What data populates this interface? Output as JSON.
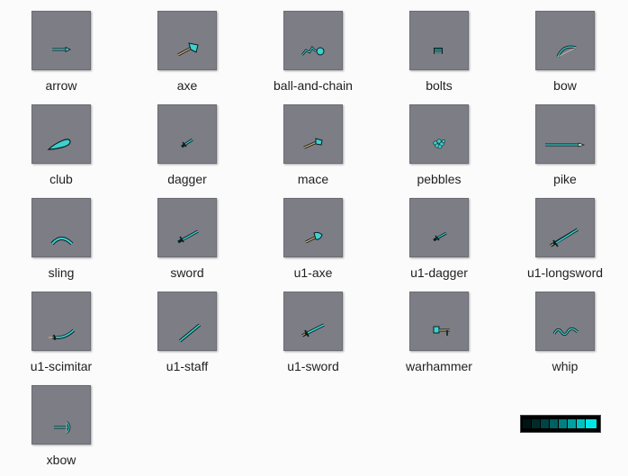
{
  "items": [
    {
      "label": "arrow",
      "icon": "arrow-icon"
    },
    {
      "label": "axe",
      "icon": "axe-icon"
    },
    {
      "label": "ball-and-chain",
      "icon": "ball-and-chain-icon"
    },
    {
      "label": "bolts",
      "icon": "bolts-icon"
    },
    {
      "label": "bow",
      "icon": "bow-icon"
    },
    {
      "label": "club",
      "icon": "club-icon"
    },
    {
      "label": "dagger",
      "icon": "dagger-icon"
    },
    {
      "label": "mace",
      "icon": "mace-icon"
    },
    {
      "label": "pebbles",
      "icon": "pebbles-icon"
    },
    {
      "label": "pike",
      "icon": "pike-icon"
    },
    {
      "label": "sling",
      "icon": "sling-icon"
    },
    {
      "label": "sword",
      "icon": "sword-icon"
    },
    {
      "label": "u1-axe",
      "icon": "axe-icon"
    },
    {
      "label": "u1-dagger",
      "icon": "dagger-icon"
    },
    {
      "label": "u1-longsword",
      "icon": "longsword-icon"
    },
    {
      "label": "u1-scimitar",
      "icon": "scimitar-icon"
    },
    {
      "label": "u1-staff",
      "icon": "staff-icon"
    },
    {
      "label": "u1-sword",
      "icon": "sword-icon"
    },
    {
      "label": "warhammer",
      "icon": "warhammer-icon"
    },
    {
      "label": "whip",
      "icon": "whip-icon"
    },
    {
      "label": "xbow",
      "icon": "crossbow-icon"
    }
  ],
  "colors": {
    "thumb_bg": "#7d7d85",
    "weapon_accent": "#3fd0d0",
    "weapon_outline": "#0a1f1f",
    "palette": [
      "#001414",
      "#002a2a",
      "#004444",
      "#006060",
      "#008080",
      "#00a0a0",
      "#00c4c4",
      "#00e6e6"
    ]
  }
}
